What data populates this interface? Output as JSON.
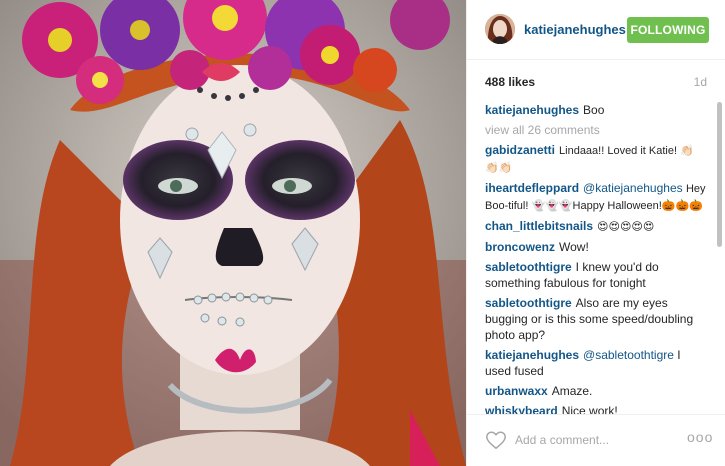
{
  "header": {
    "username": "katiejanehughes",
    "follow_label": "FOLLOWING"
  },
  "meta": {
    "likes": "488 likes",
    "time_ago": "1d"
  },
  "caption": {
    "user": "katiejanehughes",
    "text": "Boo"
  },
  "view_all": "view all 26 comments",
  "comments": [
    {
      "user": "gabidzanetti",
      "text": "Lindaaa!! Loved it Katie! 👏🏻👏🏻👏🏻"
    },
    {
      "user": "iheartdefleppard",
      "mention": "@katiejanehughes",
      "text": "Hey Boo-tiful! 👻👻👻Happy Halloween!🎃🎃🎃"
    },
    {
      "user": "chan_littlebitsnails",
      "text": "😍😍😍😍😍"
    },
    {
      "user": "broncowenz",
      "text": "Wow!"
    },
    {
      "user": "sabletoothtigre",
      "text": "I knew you'd do something fabulous for tonight"
    },
    {
      "user": "sabletoothtigre",
      "text": "Also are my eyes bugging or is this some speed/doubling photo app?"
    },
    {
      "user": "katiejanehughes",
      "mention": "@sabletoothtigre",
      "text": "I used fused"
    },
    {
      "user": "urbanwaxx",
      "text": "Amaze."
    },
    {
      "user": "whiskybeard",
      "text": "Nice work!"
    }
  ],
  "comment_box": {
    "placeholder": "Add a comment..."
  },
  "more_label": "ooo",
  "colors": {
    "username_blue": "#125688",
    "following_green": "#70c050",
    "muted_gray": "#a5a7aa"
  },
  "icons": [
    "heart-icon",
    "more-options-icon"
  ]
}
